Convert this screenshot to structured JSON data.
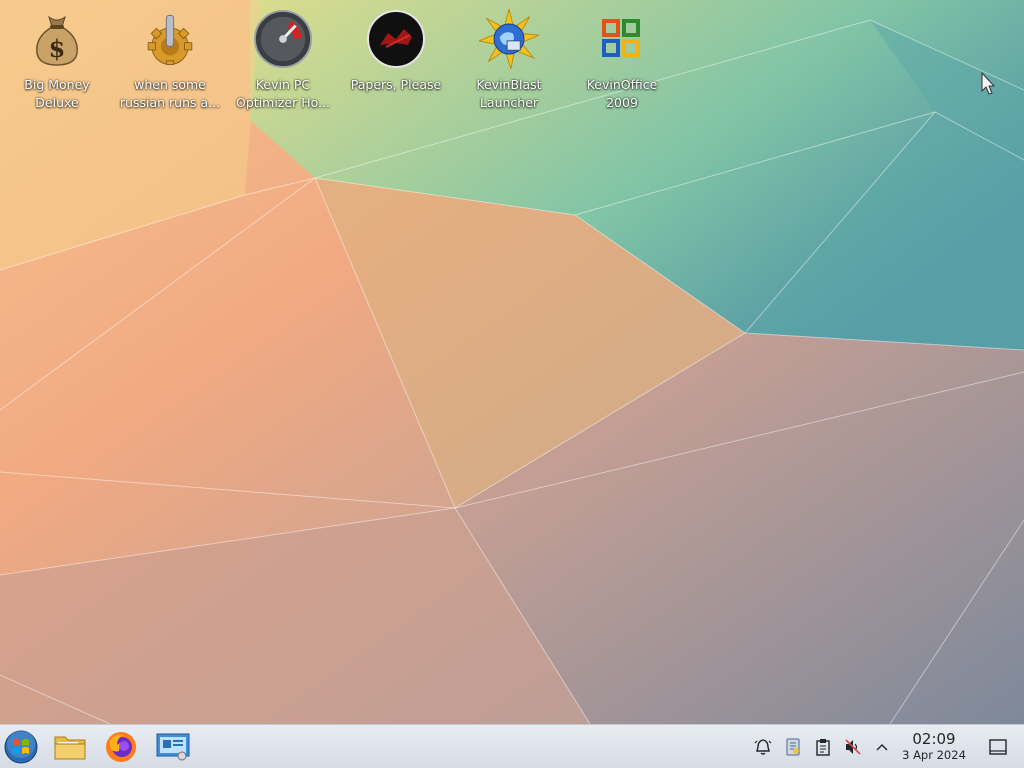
{
  "desktop": {
    "icons": [
      {
        "label": "Big Money\nDeluxe",
        "icon": "money-bag-icon"
      },
      {
        "label": "when some\nrussian runs a...",
        "icon": "gear-joystick-icon"
      },
      {
        "label": "Kevin PC\nOptimizer Ho...",
        "icon": "speedometer-icon"
      },
      {
        "label": "Papers, Please",
        "icon": "papers-please-icon"
      },
      {
        "label": "KevinBlast\nLauncher",
        "icon": "globe-starburst-icon"
      },
      {
        "label": "KevinOffice\n2009",
        "icon": "office-logo-icon"
      }
    ]
  },
  "taskbar": {
    "launchers": [
      {
        "name": "start-button",
        "icon": "windows-orb-icon"
      },
      {
        "name": "file-manager-launcher",
        "icon": "folder-icon"
      },
      {
        "name": "firefox-launcher",
        "icon": "firefox-icon"
      },
      {
        "name": "system-settings-launcher",
        "icon": "control-panel-icon"
      }
    ],
    "tray": [
      "notifications-bell-icon",
      "clipboard-tag-icon",
      "clipboard-icon",
      "volume-muted-icon",
      "tray-expand-chevron-icon"
    ],
    "clock": {
      "time": "02:09",
      "date": "3 Apr 2024"
    }
  },
  "colors": {
    "taskbar": "#dfe4ea",
    "label_text": "#ffffff"
  }
}
